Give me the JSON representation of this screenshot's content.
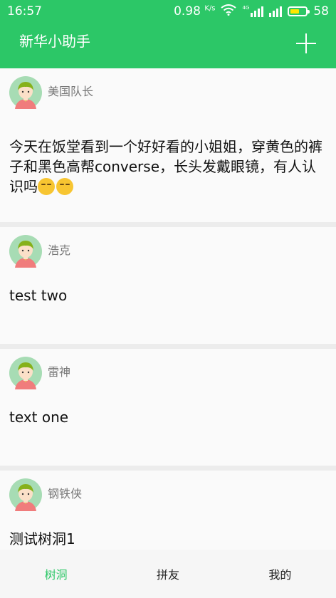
{
  "status_bar": {
    "time": "16:57",
    "speed": "0.98",
    "speed_unit": "K/s",
    "network": "4G",
    "battery": "58",
    "battery_level": 0.58
  },
  "app": {
    "title": "新华小助手",
    "add_icon": "plus-icon",
    "accent_color": "#2cc767"
  },
  "posts": [
    {
      "author": "美国队长",
      "text": "今天在饭堂看到一个好好看的小姐姐，穿黄色的裤子和黑色高帮converse，长头发戴眼镜，有人认识吗",
      "emojis": [
        "smirk-emoji",
        "smirk-emoji"
      ]
    },
    {
      "author": "浩克",
      "text": "test two"
    },
    {
      "author": "雷神",
      "text": "text one"
    },
    {
      "author": "钢铁侠",
      "text": "测试树洞1"
    }
  ],
  "tabs": [
    {
      "label": "树洞",
      "active": true
    },
    {
      "label": "拼友",
      "active": false
    },
    {
      "label": "我的",
      "active": false
    }
  ]
}
